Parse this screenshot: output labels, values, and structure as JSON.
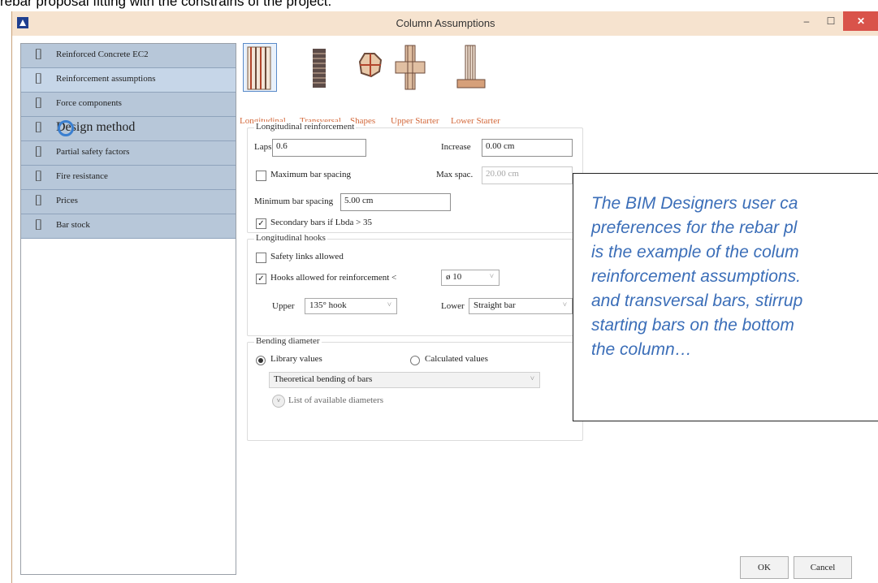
{
  "caption_above": "rebar proposal fitting with the constrains of the project.",
  "window": {
    "title": "Column Assumptions",
    "minimize": "–",
    "maximize": "☐",
    "close": "✕"
  },
  "sidebar": {
    "items": [
      {
        "label": "Reinforced Concrete EC2"
      },
      {
        "label": "Reinforcement assumptions"
      },
      {
        "label": "Force components"
      },
      {
        "label": "Design method"
      },
      {
        "label": "Partial safety factors"
      },
      {
        "label": "Fire resistance"
      },
      {
        "label": "Prices"
      },
      {
        "label": "Bar stock"
      }
    ]
  },
  "tabs": [
    {
      "label": "Longitudinal",
      "icon": "longitudinal-bars-icon"
    },
    {
      "label": "Transversal",
      "icon": "transversal-bars-icon"
    },
    {
      "label": "Shapes",
      "icon": "shapes-icon"
    },
    {
      "label": "Upper Starter",
      "icon": "upper-starter-icon"
    },
    {
      "label": "Lower Starter",
      "icon": "lower-starter-icon"
    }
  ],
  "longitudinal_reinforcement": {
    "title": "Longitudinal reinforcement",
    "laps_label": "Laps",
    "laps_value": "0.6",
    "increase_label": "Increase",
    "increase_value": "0.00 cm",
    "max_bar_spacing_label": "Maximum bar spacing",
    "max_spac_label": "Max spac.",
    "max_spac_value": "20.00 cm",
    "min_bar_spacing_label": "Minimum bar spacing",
    "min_bar_spacing_value": "5.00 cm",
    "secondary_bars_label": "Secondary bars if Lbda > 35"
  },
  "longitudinal_hooks": {
    "title": "Longitudinal hooks",
    "safety_links_label": "Safety links allowed",
    "hooks_allowed_label": "Hooks allowed for reinforcement <",
    "hooks_diameter": "ø 10",
    "upper_label": "Upper",
    "upper_value": "135° hook",
    "lower_label": "Lower",
    "lower_value": "Straight bar"
  },
  "bending_diameter": {
    "title": "Bending diameter",
    "library_values": "Library values",
    "calculated_values": "Calculated values",
    "theoretical": "Theoretical bending of bars",
    "list_available": "List of available diameters"
  },
  "callout_lines": [
    "The BIM Designers user ca",
    "preferences for the rebar pl",
    "is the example of the colum",
    "reinforcement assumptions.",
    "and transversal bars, stirrup",
    "starting bars on the bottom",
    "the column…"
  ],
  "buttons": {
    "ok": "OK",
    "cancel": "Cancel"
  },
  "colors": {
    "accent": "#3b6eb8",
    "tab_label": "#d3683a",
    "sidebar": "#b7c7d9"
  }
}
